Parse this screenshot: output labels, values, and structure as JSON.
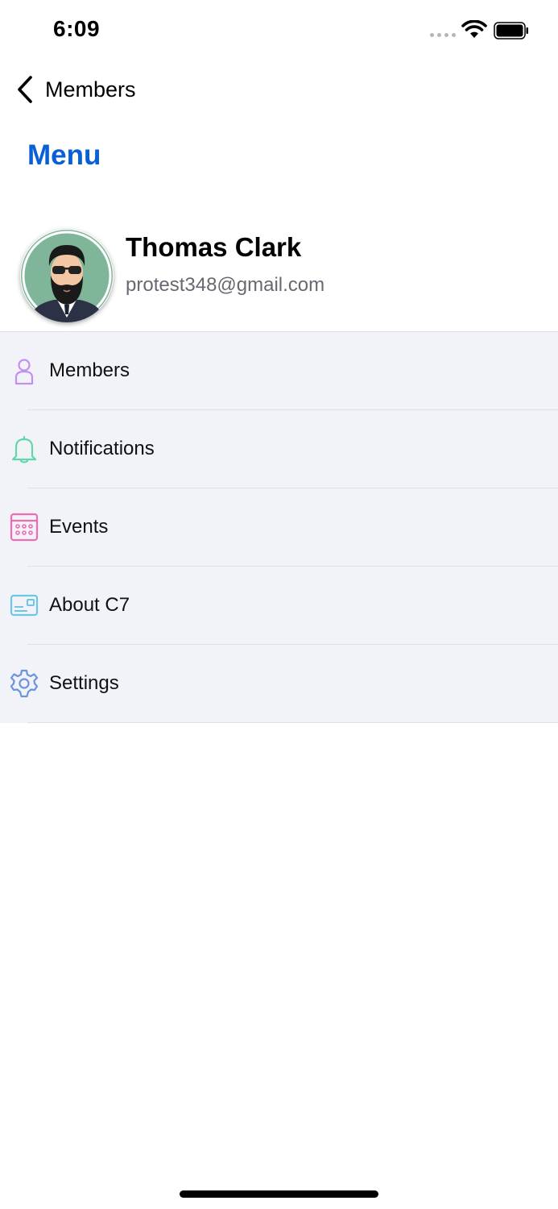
{
  "status_bar": {
    "time": "6:09"
  },
  "nav": {
    "back_label": "Members"
  },
  "page": {
    "title": "Menu"
  },
  "profile": {
    "name": "Thomas Clark",
    "email": "protest348@gmail.com"
  },
  "menu": {
    "items": [
      {
        "label": "Members",
        "icon": "person-icon",
        "color": "#c38ff0"
      },
      {
        "label": "Notifications",
        "icon": "bell-icon",
        "color": "#5fd7a9"
      },
      {
        "label": "Events",
        "icon": "calendar-icon",
        "color": "#f06ab4"
      },
      {
        "label": "About C7",
        "icon": "id-card-icon",
        "color": "#6ec6e6"
      },
      {
        "label": "Settings",
        "icon": "gear-icon",
        "color": "#6b93e0"
      }
    ]
  },
  "colors": {
    "accent": "#0a5fd6",
    "list_background": "#f2f3f8"
  }
}
